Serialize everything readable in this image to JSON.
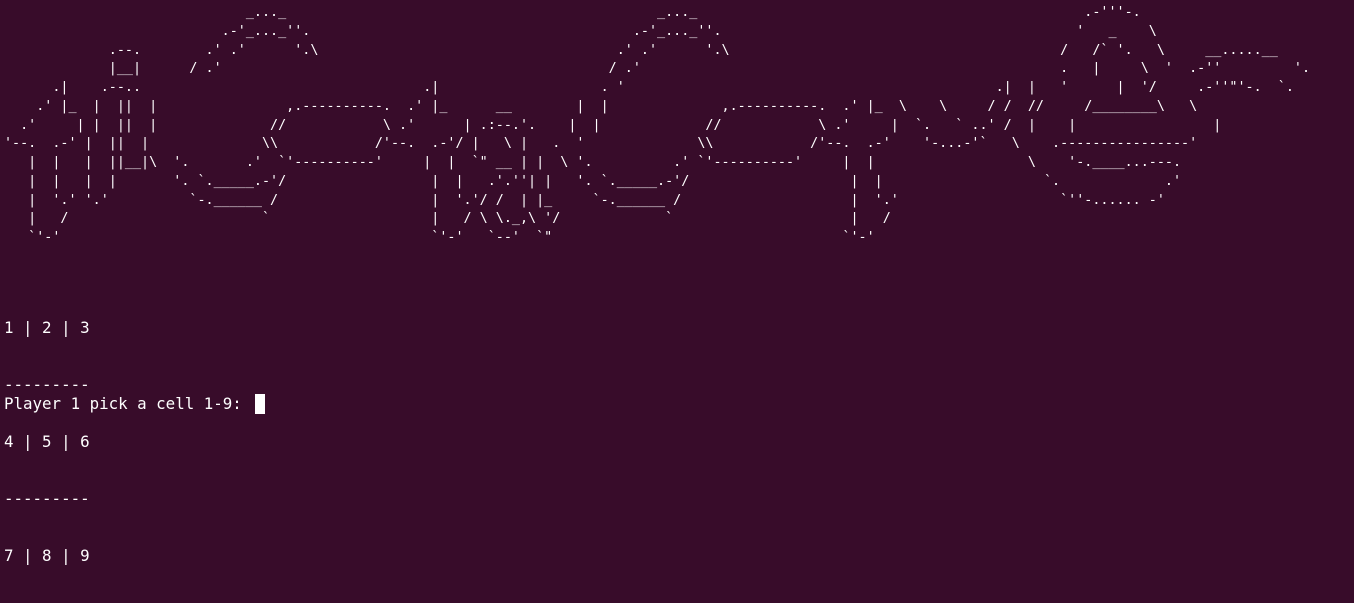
{
  "terminal": {
    "banner_lines": [
      "                              _..._                                              _..._                                                .-'''-.",
      "                           .-'_..._''.                                        .-'_..._''.                                            '   _    \\",
      "             .--.        .' .'      '.\\                                     .' .'      '.\\                                         /   /` '.   \\     __.....__",
      "             |__|      / .'                                                / .'                                                    .   |     \\  '  .-''         '.",
      "      .|    .--..                                   .|                    . '                                              .|  |   '      |  '/     .-''\"'-.  `.",
      "    .' |_  |  ||  |                ,.----------.  .' |_      __        |  |              ,.----------.  .' |_  \\    \\     / /  //     /________\\   \\",
      "  .'     | |  ||  |              //            \\ .'      | .:--.'.    |  |             //            \\ .'     |  `.   ` ..' /  |    |                 |",
      "'--.  .-' |  ||  |              \\\\            /'--.  .-'/ |   \\ |   .  '              \\\\            /'--.  .-'    '-...-'`   \\    .----------------'",
      "   |  |   |  ||__|\\  '.       .'  `'----------'     |  |  `\" __ | |  \\ '.          .' `'----------'     |  |                   \\    '-.____...---.",
      "   |  |   |  |       '. `._____.-'/                  |  |   .'.''| |   '. `._____.-'/                    |  |                    `.             .'",
      "   |  '.' '.'          `-.______ /                   |  '.'/ /  | |_     `-.______ /                     |  '.'                    `''-...... -'",
      "   |   /                        `                    |   / \\ \\._,\\ '/             `                      |   /",
      "   `'-'                                              `'-'   `--'  `\"                                    `'-'"
    ],
    "board_rows": [
      "1 | 2 | 3",
      "---------",
      "4 | 5 | 6",
      "---------",
      "7 | 8 | 9"
    ],
    "prompt": "Player 1 pick a cell 1-9: "
  },
  "colors": {
    "background": "#380c2a",
    "foreground": "#ffffff",
    "cursor": "#ffffff"
  }
}
